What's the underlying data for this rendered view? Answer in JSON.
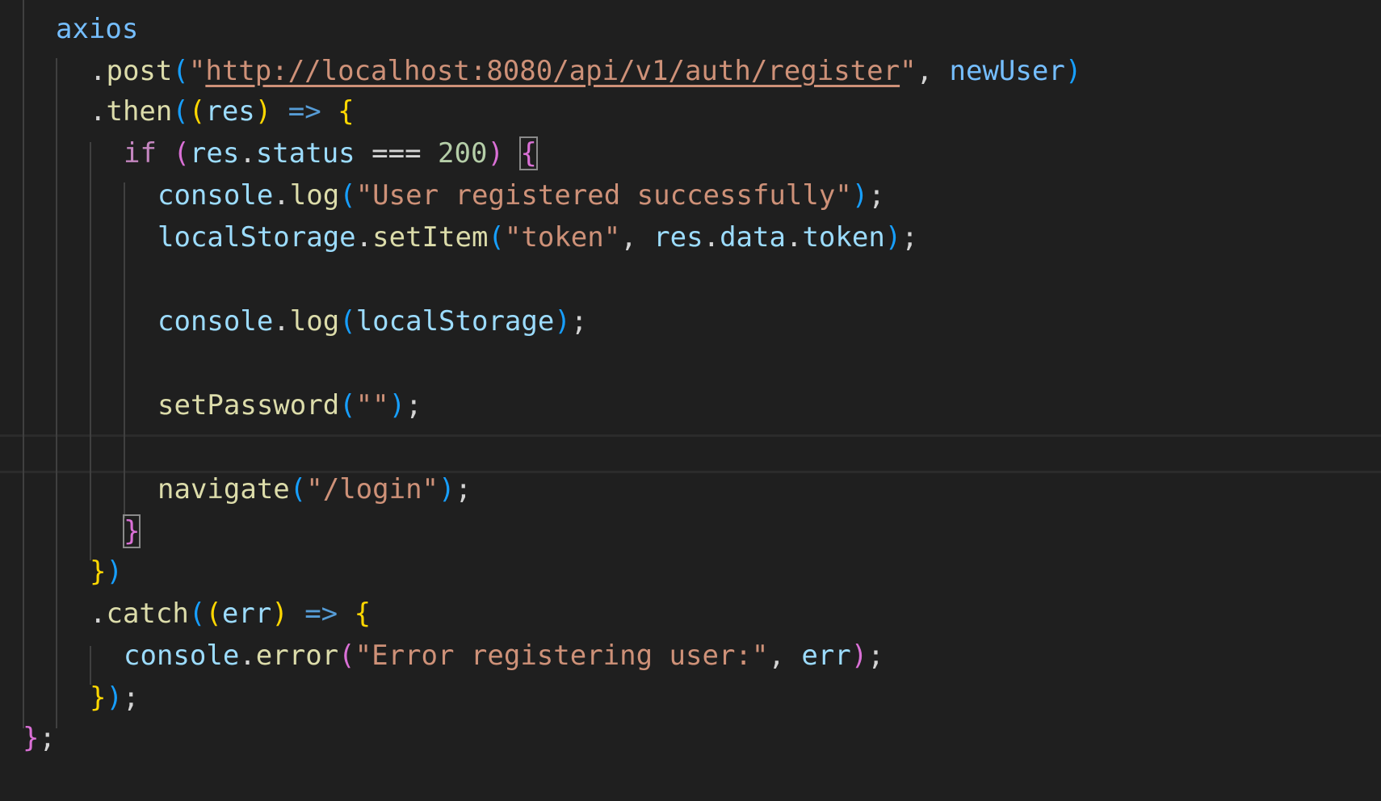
{
  "colors": {
    "background": "#1f1f1f",
    "variable": "#9cdcfe",
    "function": "#dcdcaa",
    "string": "#ce9178",
    "keyword_control": "#c586c0",
    "keyword_storage": "#569cd6",
    "number": "#b5cea8",
    "punctuation": "#d4d4d4",
    "bracket_gold": "#ffd700",
    "bracket_purple": "#da70d6",
    "bracket_blue": "#179fff",
    "indent_guide": "#404040"
  },
  "lines": [
    {
      "tokens": [
        {
          "t": "axios",
          "k": "variable_blue"
        }
      ]
    },
    {
      "tokens": [
        {
          "t": ".",
          "k": "punct"
        },
        {
          "t": "post",
          "k": "function"
        },
        {
          "t": "(",
          "k": "bracket_blue"
        },
        {
          "t": "\"",
          "k": "string"
        },
        {
          "t": "http://localhost:8080/api/v1/auth/register",
          "k": "string_url"
        },
        {
          "t": "\"",
          "k": "string"
        },
        {
          "t": ", ",
          "k": "punct"
        },
        {
          "t": "newUser",
          "k": "variable_blue"
        },
        {
          "t": ")",
          "k": "bracket_blue"
        }
      ]
    },
    {
      "tokens": [
        {
          "t": ".",
          "k": "punct"
        },
        {
          "t": "then",
          "k": "function"
        },
        {
          "t": "(",
          "k": "bracket_blue"
        },
        {
          "t": "(",
          "k": "bracket_gold"
        },
        {
          "t": "res",
          "k": "variable"
        },
        {
          "t": ")",
          "k": "bracket_gold"
        },
        {
          "t": " ",
          "k": "punct"
        },
        {
          "t": "=>",
          "k": "keyword_storage"
        },
        {
          "t": " ",
          "k": "punct"
        },
        {
          "t": "{",
          "k": "bracket_gold"
        }
      ]
    },
    {
      "tokens": [
        {
          "t": "if",
          "k": "keyword_control"
        },
        {
          "t": " ",
          "k": "punct"
        },
        {
          "t": "(",
          "k": "bracket_purple"
        },
        {
          "t": "res",
          "k": "variable"
        },
        {
          "t": ".",
          "k": "punct"
        },
        {
          "t": "status",
          "k": "variable"
        },
        {
          "t": " === ",
          "k": "punct"
        },
        {
          "t": "200",
          "k": "number"
        },
        {
          "t": ")",
          "k": "bracket_purple"
        },
        {
          "t": " ",
          "k": "punct"
        },
        {
          "t": "{",
          "k": "bracket_purple_box"
        }
      ]
    },
    {
      "tokens": [
        {
          "t": "console",
          "k": "variable"
        },
        {
          "t": ".",
          "k": "punct"
        },
        {
          "t": "log",
          "k": "function"
        },
        {
          "t": "(",
          "k": "bracket_blue"
        },
        {
          "t": "\"User registered successfully\"",
          "k": "string"
        },
        {
          "t": ")",
          "k": "bracket_blue"
        },
        {
          "t": ";",
          "k": "punct"
        }
      ]
    },
    {
      "tokens": [
        {
          "t": "localStorage",
          "k": "variable"
        },
        {
          "t": ".",
          "k": "punct"
        },
        {
          "t": "setItem",
          "k": "function"
        },
        {
          "t": "(",
          "k": "bracket_blue"
        },
        {
          "t": "\"token\"",
          "k": "string"
        },
        {
          "t": ", ",
          "k": "punct"
        },
        {
          "t": "res",
          "k": "variable"
        },
        {
          "t": ".",
          "k": "punct"
        },
        {
          "t": "data",
          "k": "variable"
        },
        {
          "t": ".",
          "k": "punct"
        },
        {
          "t": "token",
          "k": "variable"
        },
        {
          "t": ")",
          "k": "bracket_blue"
        },
        {
          "t": ";",
          "k": "punct"
        }
      ]
    },
    {
      "tokens": []
    },
    {
      "tokens": [
        {
          "t": "console",
          "k": "variable"
        },
        {
          "t": ".",
          "k": "punct"
        },
        {
          "t": "log",
          "k": "function"
        },
        {
          "t": "(",
          "k": "bracket_blue"
        },
        {
          "t": "localStorage",
          "k": "variable"
        },
        {
          "t": ")",
          "k": "bracket_blue"
        },
        {
          "t": ";",
          "k": "punct"
        }
      ]
    },
    {
      "tokens": []
    },
    {
      "tokens": [
        {
          "t": "setPassword",
          "k": "function"
        },
        {
          "t": "(",
          "k": "bracket_blue"
        },
        {
          "t": "\"\"",
          "k": "string"
        },
        {
          "t": ")",
          "k": "bracket_blue"
        },
        {
          "t": ";",
          "k": "punct"
        }
      ]
    },
    {
      "tokens": []
    },
    {
      "tokens": [
        {
          "t": "navigate",
          "k": "function"
        },
        {
          "t": "(",
          "k": "bracket_blue"
        },
        {
          "t": "\"/login\"",
          "k": "string"
        },
        {
          "t": ")",
          "k": "bracket_blue"
        },
        {
          "t": ";",
          "k": "punct"
        }
      ]
    },
    {
      "tokens": [
        {
          "t": "}",
          "k": "bracket_purple_box"
        }
      ]
    },
    {
      "tokens": [
        {
          "t": "}",
          "k": "bracket_gold"
        },
        {
          "t": ")",
          "k": "bracket_blue"
        }
      ]
    },
    {
      "tokens": [
        {
          "t": ".",
          "k": "punct"
        },
        {
          "t": "catch",
          "k": "function"
        },
        {
          "t": "(",
          "k": "bracket_blue"
        },
        {
          "t": "(",
          "k": "bracket_gold"
        },
        {
          "t": "err",
          "k": "variable"
        },
        {
          "t": ")",
          "k": "bracket_gold"
        },
        {
          "t": " ",
          "k": "punct"
        },
        {
          "t": "=>",
          "k": "keyword_storage"
        },
        {
          "t": " ",
          "k": "punct"
        },
        {
          "t": "{",
          "k": "bracket_gold"
        }
      ]
    },
    {
      "tokens": [
        {
          "t": "console",
          "k": "variable"
        },
        {
          "t": ".",
          "k": "punct"
        },
        {
          "t": "error",
          "k": "function"
        },
        {
          "t": "(",
          "k": "bracket_purple"
        },
        {
          "t": "\"Error registering user:\"",
          "k": "string"
        },
        {
          "t": ", ",
          "k": "punct"
        },
        {
          "t": "err",
          "k": "variable"
        },
        {
          "t": ")",
          "k": "bracket_purple"
        },
        {
          "t": ";",
          "k": "punct"
        }
      ]
    },
    {
      "tokens": [
        {
          "t": "}",
          "k": "bracket_gold"
        },
        {
          "t": ")",
          "k": "bracket_blue"
        },
        {
          "t": ";",
          "k": "punct"
        }
      ]
    },
    {
      "tokens": [
        {
          "t": "}",
          "k": "bracket_purple"
        },
        {
          "t": ";",
          "k": "punct"
        }
      ]
    }
  ]
}
